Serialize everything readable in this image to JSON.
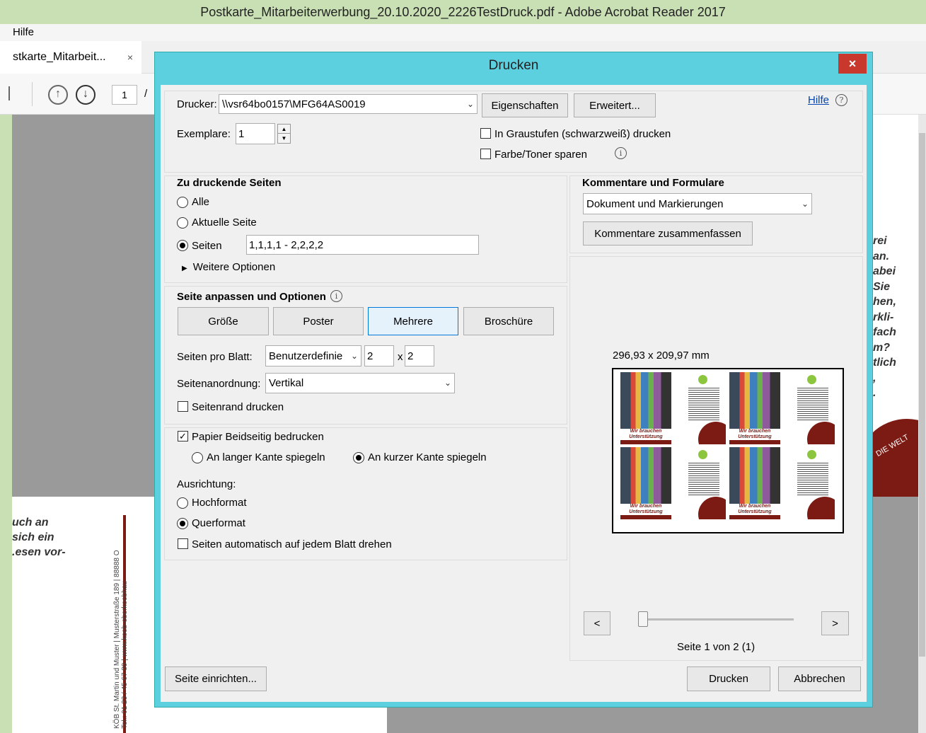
{
  "window": {
    "title": "Postkarte_Mitarbeiterwerbung_20.10.2020_2226TestDruck.pdf - Adobe Acrobat Reader 2017",
    "menu_help": "Hilfe",
    "tab_label": "stkarte_Mitarbeit...",
    "tab_close": "×",
    "page_number": "1",
    "page_sep": "/"
  },
  "background_doc": {
    "left_text_lines": [
      "uch an",
      "sich ein",
      ".esen vor-"
    ],
    "address": "KÖB St. Martin und Muster | Musterstraße 189 | 88888 O",
    "phone": "Tel.: 01 23 / 45 67 89 | www.koeb-oberkoebhau",
    "right_text_lines": [
      "rei",
      "an.",
      "abei",
      "Sie",
      "hen,",
      "rkli-",
      "fach",
      "m?",
      "tlich",
      ",",
      "."
    ],
    "right_curve_text": "DIE WELT"
  },
  "dialog": {
    "title": "Drucken",
    "close": "×",
    "printer_label": "Drucker:",
    "printer_value": "\\\\vsr64bo0157\\MFG64AS0019",
    "properties_button": "Eigenschaften",
    "advanced_button": "Erweitert...",
    "help_link": "Hilfe",
    "copies_label": "Exemplare:",
    "copies_value": "1",
    "grayscale_label": "In Graustufen (schwarzweiß) drucken",
    "grayscale_checked": false,
    "save_toner_label": "Farbe/Toner sparen",
    "save_toner_checked": false,
    "pages_section": {
      "heading": "Zu druckende Seiten",
      "all": "Alle",
      "current": "Aktuelle Seite",
      "pages": "Seiten",
      "pages_value": "1,1,1,1 - 2,2,2,2",
      "selected": "pages",
      "more_options": "Weitere Optionen"
    },
    "fit_section": {
      "heading": "Seite anpassen und Optionen",
      "size_button": "Größe",
      "poster_button": "Poster",
      "multiple_button": "Mehrere",
      "booklet_button": "Broschüre",
      "selected": "multiple",
      "pages_per_sheet_label": "Seiten pro Blatt:",
      "pages_per_sheet_value": "Benutzerdefinie",
      "cols": "2",
      "times": "x",
      "rows": "2",
      "order_label": "Seitenanordnung:",
      "order_value": "Vertikal",
      "print_border_label": "Seitenrand drucken",
      "print_border_checked": false
    },
    "duplex_section": {
      "label": "Papier Beidseitig bedrucken",
      "checked": true,
      "long_edge": "An langer Kante spiegeln",
      "short_edge": "An kurzer Kante spiegeln",
      "selected": "short",
      "orientation_label": "Ausrichtung:",
      "portrait": "Hochformat",
      "landscape": "Querformat",
      "orientation_selected": "landscape",
      "auto_rotate_label": "Seiten automatisch auf jedem Blatt drehen",
      "auto_rotate_checked": false
    },
    "comments_section": {
      "heading": "Kommentare und Formulare",
      "value": "Dokument und Markierungen",
      "summarize_button": "Kommentare zusammenfassen"
    },
    "preview": {
      "dimensions": "296,93 x 209,97 mm",
      "card_caption_1": "Wir brauchen",
      "card_caption_2": "Unterstützung",
      "prev_button": "<",
      "next_button": ">",
      "page_status": "Seite 1 von 2 (1)",
      "slider_position": 0
    },
    "page_setup_button": "Seite einrichten...",
    "print_button": "Drucken",
    "cancel_button": "Abbrechen"
  },
  "colors": {
    "dialog_frame": "#5dd0e0",
    "close_red": "#c8382d",
    "brand_red": "#7c1b14",
    "desktop_green": "#c9e0b5"
  }
}
